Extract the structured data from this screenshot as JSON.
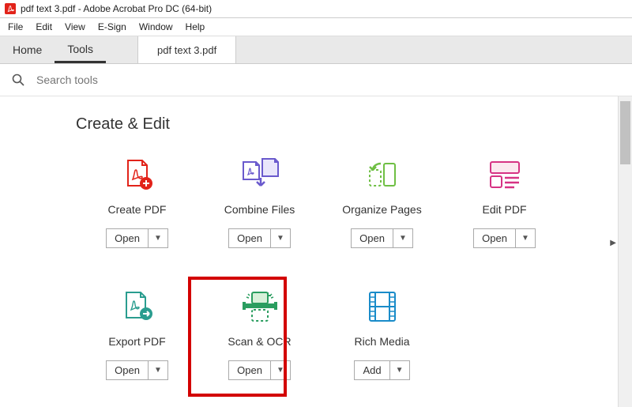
{
  "title": "pdf text 3.pdf - Adobe Acrobat Pro DC (64-bit)",
  "menu": [
    "File",
    "Edit",
    "View",
    "E-Sign",
    "Window",
    "Help"
  ],
  "tabs": {
    "home": "Home",
    "tools": "Tools",
    "doc": "pdf text 3.pdf"
  },
  "search": {
    "placeholder": "Search tools"
  },
  "section": "Create & Edit",
  "tools": [
    {
      "label": "Create PDF",
      "action": "Open"
    },
    {
      "label": "Combine Files",
      "action": "Open"
    },
    {
      "label": "Organize Pages",
      "action": "Open"
    },
    {
      "label": "Edit PDF",
      "action": "Open"
    },
    {
      "label": "Export PDF",
      "action": "Open"
    },
    {
      "label": "Scan & OCR",
      "action": "Open"
    },
    {
      "label": "Rich Media",
      "action": "Add"
    }
  ]
}
